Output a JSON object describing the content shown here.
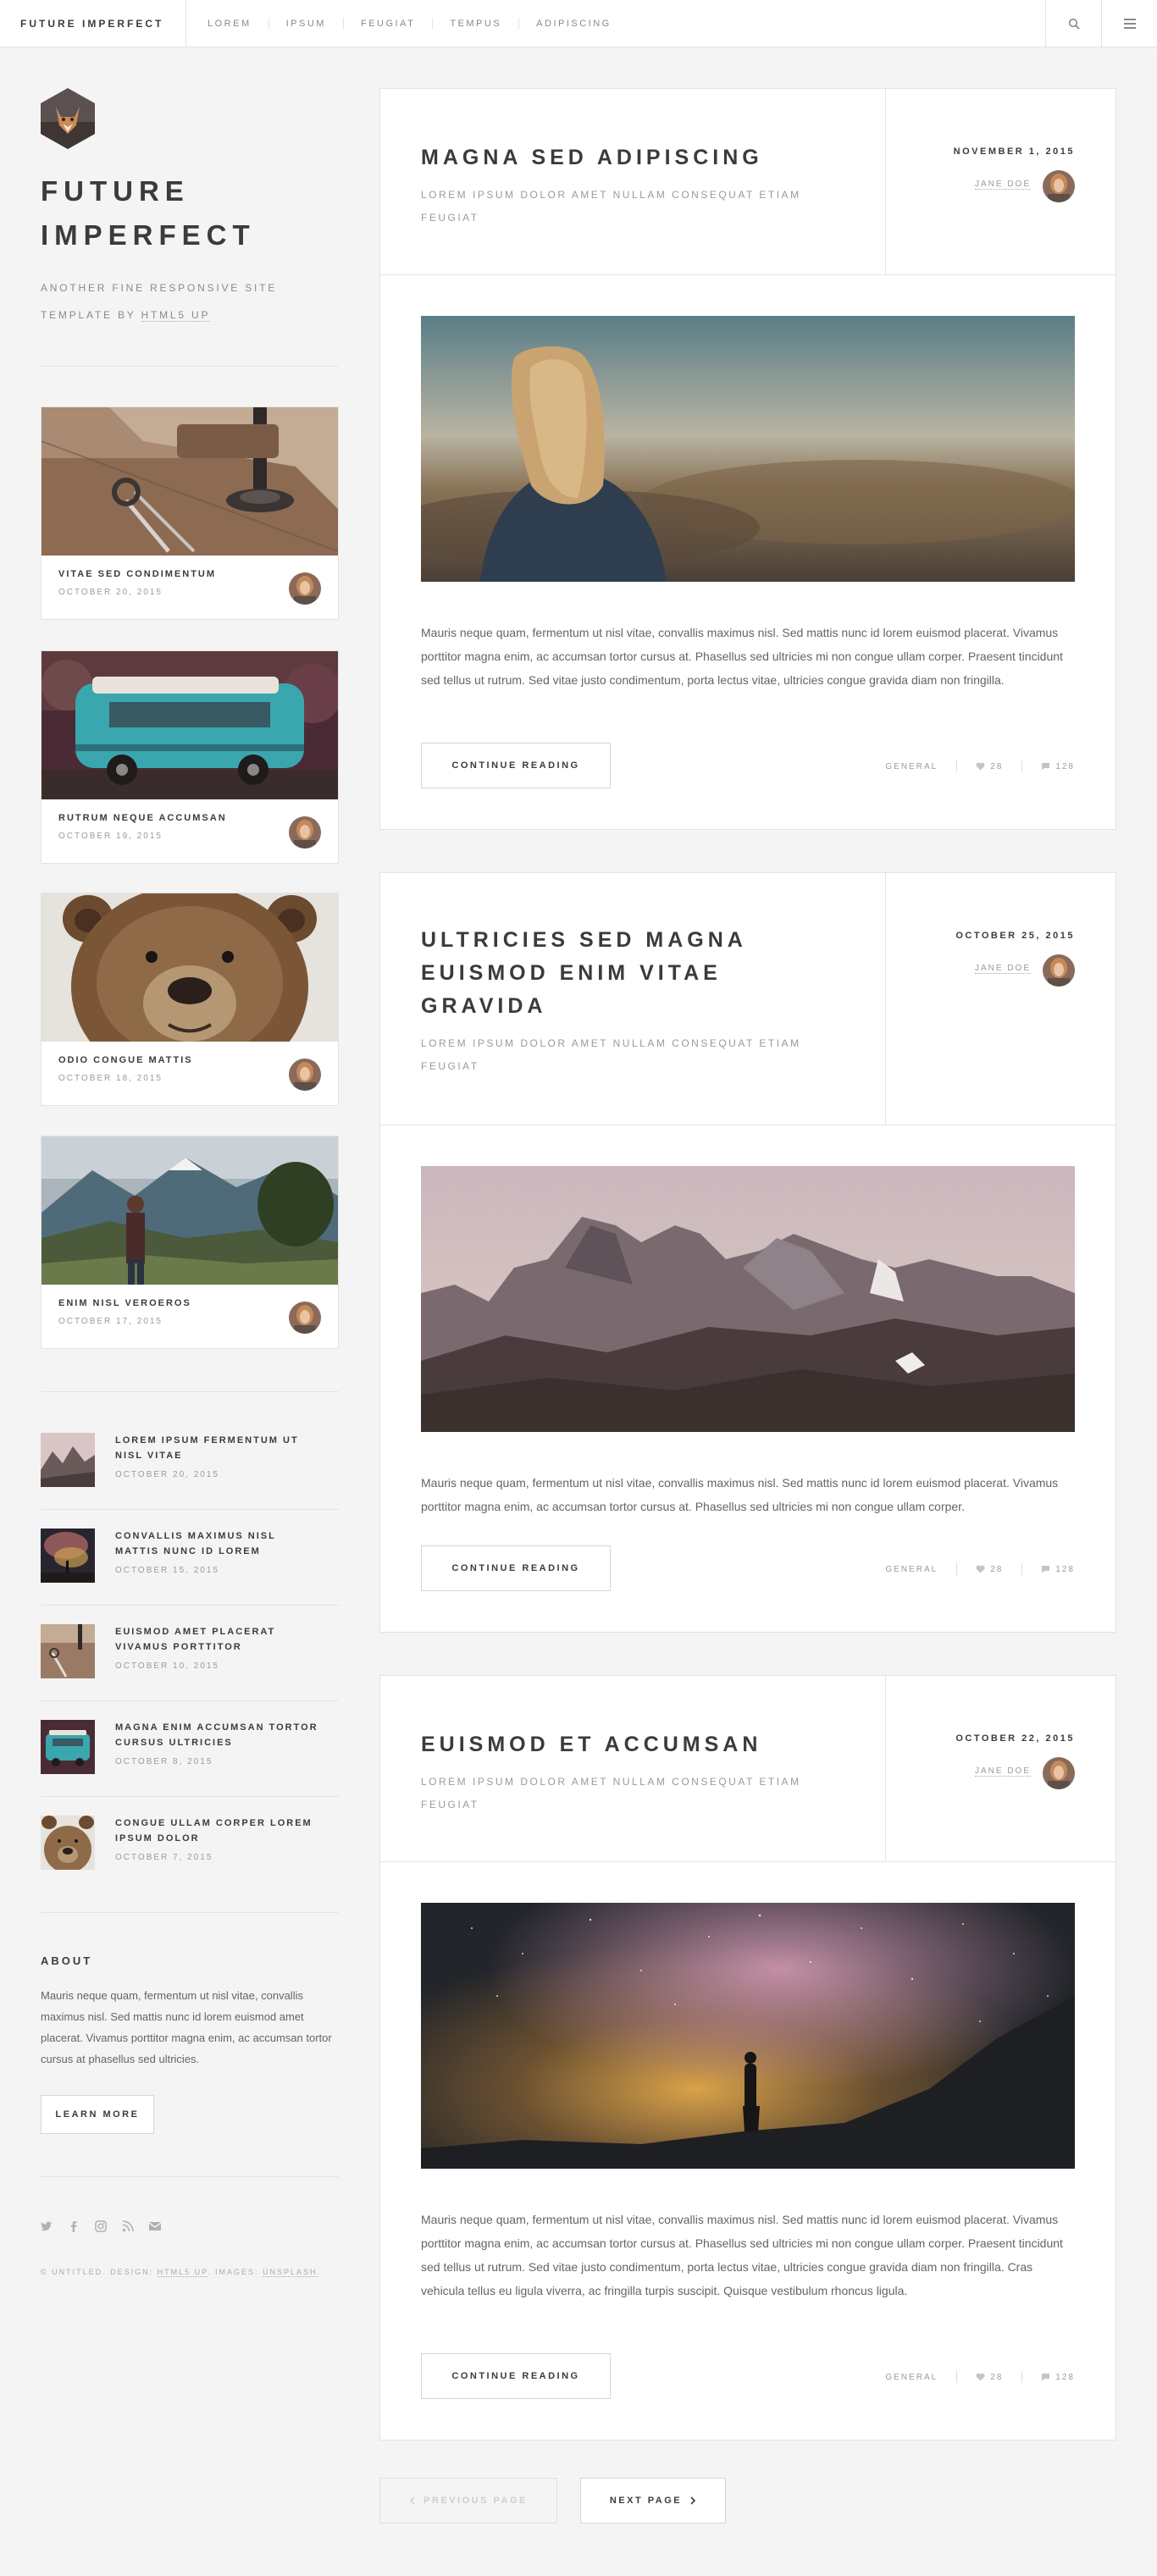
{
  "header": {
    "brand": "FUTURE IMPERFECT",
    "nav": [
      "LOREM",
      "IPSUM",
      "FEUGIAT",
      "TEMPUS",
      "ADIPISCING"
    ],
    "search_icon": "search-icon",
    "menu_icon": "menu-icon"
  },
  "intro": {
    "title_line1": "FUTURE",
    "title_line2": "IMPERFECT",
    "subtitle_line1": "ANOTHER FINE RESPONSIVE SITE",
    "subtitle_line2_prefix": "TEMPLATE BY ",
    "subtitle_link": "HTML5 UP"
  },
  "mini_posts": [
    {
      "title": "VITAE SED CONDIMENTUM",
      "date": "OCTOBER 20, 2015"
    },
    {
      "title": "RUTRUM NEQUE ACCUMSAN",
      "date": "OCTOBER 19, 2015"
    },
    {
      "title": "ODIO CONGUE MATTIS",
      "date": "OCTOBER 18, 2015"
    },
    {
      "title": "ENIM NISL VEROEROS",
      "date": "OCTOBER 17, 2015"
    }
  ],
  "list_posts": [
    {
      "line1": "LOREM IPSUM FERMENTUM UT",
      "line2": "NISL VITAE",
      "date": "OCTOBER 20, 2015"
    },
    {
      "line1": "CONVALLIS MAXIMUS NISL",
      "line2": "MATTIS NUNC ID LOREM",
      "date": "OCTOBER 15, 2015"
    },
    {
      "line1": "EUISMOD AMET PLACERAT",
      "line2": "VIVAMUS PORTTITOR",
      "date": "OCTOBER 10, 2015"
    },
    {
      "line1": "MAGNA ENIM ACCUMSAN TORTOR",
      "line2": "CURSUS ULTRICIES",
      "date": "OCTOBER 8, 2015"
    },
    {
      "line1": "CONGUE ULLAM CORPER LOREM",
      "line2": "IPSUM DOLOR",
      "date": "OCTOBER 7, 2015"
    }
  ],
  "about": {
    "heading": "ABOUT",
    "text": "Mauris neque quam, fermentum ut nisl vitae, convallis maximus nisl. Sed mattis nunc id lorem euismod amet placerat. Vivamus porttitor magna enim, ac accumsan tortor cursus at phasellus sed ultricies.",
    "button": "LEARN MORE"
  },
  "social_icons": [
    "twitter-icon",
    "facebook-icon",
    "instagram-icon",
    "rss-icon",
    "email-icon"
  ],
  "footer": {
    "prefix": "© UNTITLED. DESIGN: ",
    "design_link": "HTML5 UP",
    "images_label": ". IMAGES: ",
    "images_link": "UNSPLASH",
    "suffix": "."
  },
  "posts": [
    {
      "title_lines": [
        "MAGNA SED ADIPISCING"
      ],
      "subtitle_lines": [
        "LOREM IPSUM DOLOR AMET NULLAM CONSEQUAT ETIAM",
        "FEUGIAT"
      ],
      "date": "NOVEMBER 1, 2015",
      "author": "JANE DOE",
      "text": "Mauris neque quam, fermentum ut nisl vitae, convallis maximus nisl. Sed mattis nunc id lorem euismod placerat. Vivamus porttitor magna enim, ac accumsan tortor cursus at. Phasellus sed ultricies mi non congue ullam corper. Praesent tincidunt sed tellus ut rutrum. Sed vitae justo condimentum, porta lectus vitae, ultricies congue gravida diam non fringilla.",
      "button": "CONTINUE READING",
      "category": "GENERAL",
      "likes": "28",
      "comments": "128"
    },
    {
      "title_lines": [
        "ULTRICIES SED MAGNA",
        "EUISMOD ENIM VITAE",
        "GRAVIDA"
      ],
      "subtitle_lines": [
        "LOREM IPSUM DOLOR AMET NULLAM CONSEQUAT ETIAM",
        "FEUGIAT"
      ],
      "date": "OCTOBER 25, 2015",
      "author": "JANE DOE",
      "text": "Mauris neque quam, fermentum ut nisl vitae, convallis maximus nisl. Sed mattis nunc id lorem euismod placerat. Vivamus porttitor magna enim, ac accumsan tortor cursus at. Phasellus sed ultricies mi non congue ullam corper.",
      "button": "CONTINUE READING",
      "category": "GENERAL",
      "likes": "28",
      "comments": "128"
    },
    {
      "title_lines": [
        "EUISMOD ET ACCUMSAN"
      ],
      "subtitle_lines": [
        "LOREM IPSUM DOLOR AMET NULLAM CONSEQUAT ETIAM",
        "FEUGIAT"
      ],
      "date": "OCTOBER 22, 2015",
      "author": "JANE DOE",
      "text": "Mauris neque quam, fermentum ut nisl vitae, convallis maximus nisl. Sed mattis nunc id lorem euismod placerat. Vivamus porttitor magna enim, ac accumsan tortor cursus at. Phasellus sed ultricies mi non congue ullam corper. Praesent tincidunt sed tellus ut rutrum. Sed vitae justo condimentum, porta lectus vitae, ultricies congue gravida diam non fringilla. Cras vehicula tellus eu ligula viverra, ac fringilla turpis suscipit. Quisque vestibulum rhoncus ligula.",
      "button": "CONTINUE READING",
      "category": "GENERAL",
      "likes": "28",
      "comments": "128"
    }
  ],
  "pagination": {
    "previous": "PREVIOUS PAGE",
    "next": "NEXT PAGE"
  }
}
